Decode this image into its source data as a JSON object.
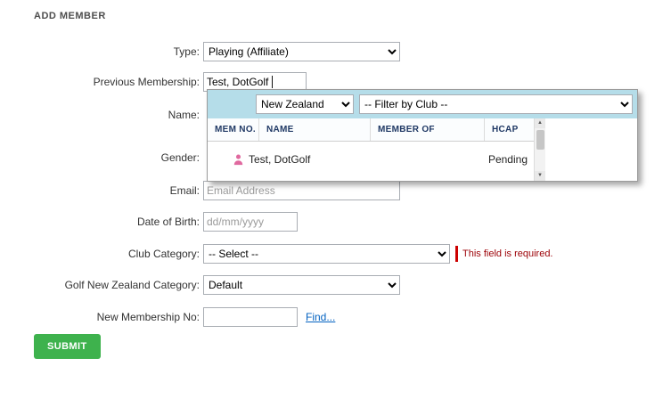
{
  "page": {
    "heading": "ADD MEMBER"
  },
  "form": {
    "type": {
      "label": "Type:",
      "value": "Playing (Affiliate)"
    },
    "previous_membership": {
      "label": "Previous Membership:",
      "value": "Test, DotGolf"
    },
    "name": {
      "label": "Name:"
    },
    "gender": {
      "label": "Gender:"
    },
    "email": {
      "label": "Email:",
      "placeholder": "Email Address"
    },
    "date_of_birth": {
      "label": "Date of Birth:",
      "placeholder": "dd/mm/yyyy"
    },
    "club_category": {
      "label": "Club Category:",
      "value": "-- Select --",
      "error": "This field is required."
    },
    "gnz_category": {
      "label": "Golf New Zealand Category:",
      "value": "Default"
    },
    "new_membership_no": {
      "label": "New Membership No:",
      "find_link": "Find..."
    },
    "submit_label": "SUBMIT"
  },
  "popup": {
    "country_filter": "New Zealand",
    "club_filter": "-- Filter by Club --",
    "table": {
      "headers": {
        "mem_no": "MEM NO.",
        "name": "NAME",
        "member_of": "MEMBER OF",
        "hcap": "HCAP"
      },
      "row": {
        "mem_no": "",
        "name": "Test, DotGolf",
        "member_of": "",
        "hcap": "Pending",
        "icon": "person-icon"
      }
    }
  },
  "icons": {
    "scroll_up_arrow": "▲",
    "scroll_down_arrow": "▼"
  },
  "colors": {
    "submit_green": "#3eb24d",
    "popup_blue": "#b5dde9",
    "error_red": "#9c0006",
    "link_blue": "#0563c1",
    "table_header_navy": "#1f3864"
  }
}
